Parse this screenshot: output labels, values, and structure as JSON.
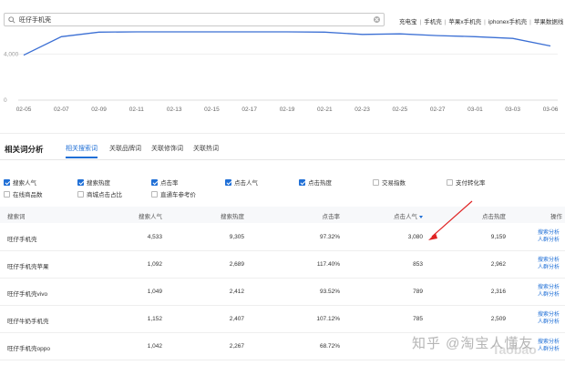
{
  "search": {
    "value": "旺仔手机壳"
  },
  "related_searches": [
    "充电宝",
    "手机壳",
    "苹果x手机壳",
    "iphonex手机壳",
    "苹果数据线"
  ],
  "chart_data": {
    "type": "line",
    "x": [
      "02-05",
      "02-07",
      "02-09",
      "02-11",
      "02-13",
      "02-15",
      "02-17",
      "02-19",
      "02-21",
      "02-23",
      "02-25",
      "02-27",
      "03-01",
      "03-03",
      "03-06"
    ],
    "y_ticks": [
      "4,000",
      "0"
    ],
    "series": [
      {
        "values": [
          3900,
          5500,
          5900,
          6300,
          6200,
          6300,
          6250,
          6100,
          5900,
          5700,
          5750,
          5600,
          5500,
          5350,
          4700
        ]
      }
    ],
    "ylim": [
      0,
      6000
    ],
    "color": "#3b6fd4"
  },
  "section": {
    "title": "相关词分析",
    "tabs": [
      "相关搜索词",
      "关联品牌词",
      "关联修饰词",
      "关联热词"
    ],
    "active_tab": 0
  },
  "options": [
    {
      "label": "搜索人气",
      "checked": true
    },
    {
      "label": "搜索热度",
      "checked": true
    },
    {
      "label": "点击率",
      "checked": true
    },
    {
      "label": "点击人气",
      "checked": true
    },
    {
      "label": "点击热度",
      "checked": true
    },
    {
      "label": "交易指数",
      "checked": false
    },
    {
      "label": "支付转化率",
      "checked": false
    },
    {
      "label": "在线商品数",
      "checked": false
    },
    {
      "label": "商城点击占比",
      "checked": false
    },
    {
      "label": "直通车参考价",
      "checked": false
    }
  ],
  "table": {
    "headers": [
      "搜索词",
      "搜索人气",
      "搜索热度",
      "点击率",
      "点击人气",
      "点击热度",
      "操作"
    ],
    "rows": [
      {
        "keyword": "旺仔手机壳",
        "search_pop": "4,533",
        "search_heat": "9,305",
        "ctr": "97.32%",
        "click_pop": "3,080",
        "click_heat": "9,159"
      },
      {
        "keyword": "旺仔手机壳苹果",
        "search_pop": "1,092",
        "search_heat": "2,689",
        "ctr": "117.40%",
        "click_pop": "853",
        "click_heat": "2,962"
      },
      {
        "keyword": "旺仔手机壳vivo",
        "search_pop": "1,049",
        "search_heat": "2,412",
        "ctr": "93.52%",
        "click_pop": "789",
        "click_heat": "2,316"
      },
      {
        "keyword": "旺仔牛奶手机壳",
        "search_pop": "1,152",
        "search_heat": "2,407",
        "ctr": "107.12%",
        "click_pop": "785",
        "click_heat": "2,509"
      },
      {
        "keyword": "旺仔手机壳oppo",
        "search_pop": "1,042",
        "search_heat": "2,267",
        "ctr": "68.72%",
        "click_pop": "",
        "click_heat": ""
      }
    ],
    "op_trend": "搜索分析",
    "op_crowd": "人群分析"
  },
  "watermark": {
    "text": "知乎 @淘宝人懂友",
    "logo": "Taobao"
  }
}
